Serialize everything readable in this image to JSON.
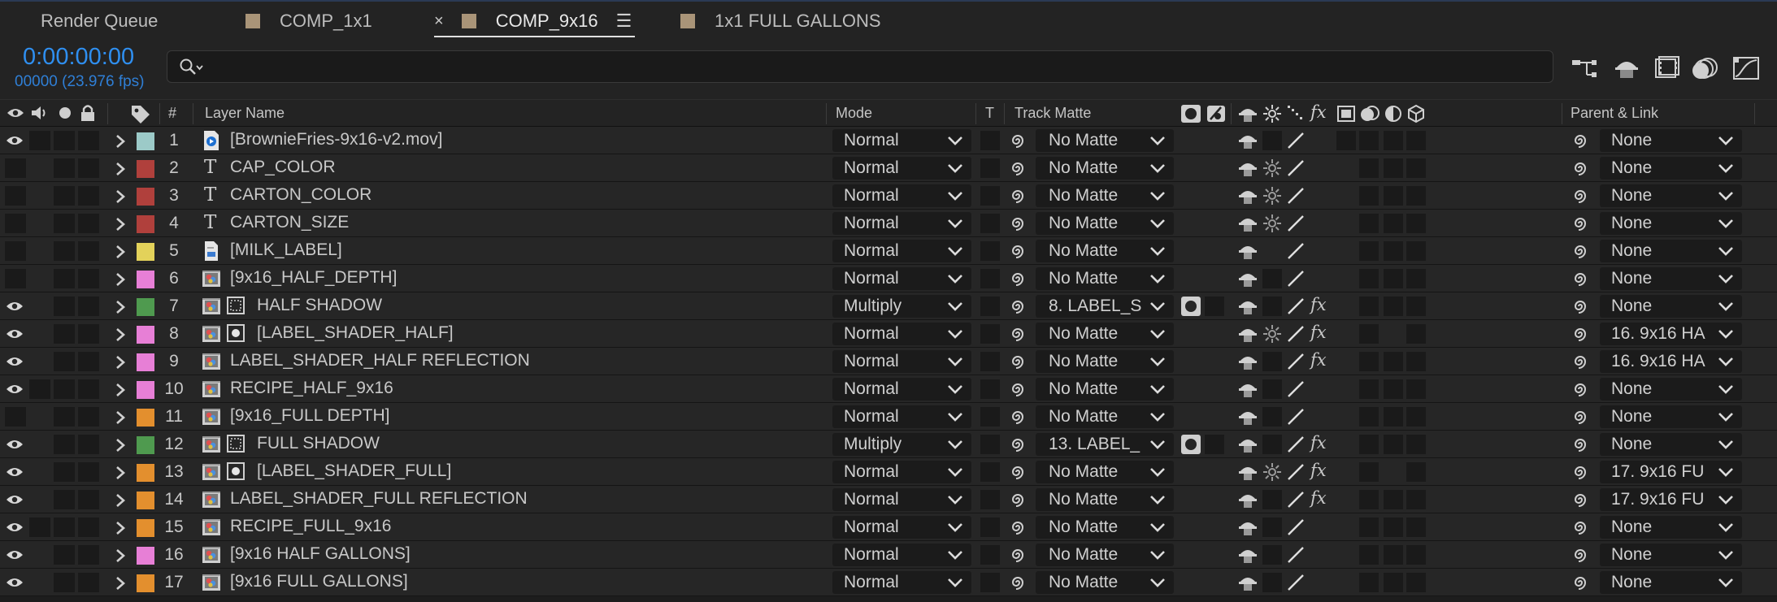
{
  "tabs": [
    {
      "label": "Render Queue",
      "swatch": false,
      "active": false,
      "close": false
    },
    {
      "label": "COMP_1x1",
      "swatch": true,
      "active": false,
      "close": false
    },
    {
      "label": "COMP_9x16",
      "swatch": true,
      "active": true,
      "close": true
    },
    {
      "label": "1x1 FULL GALLONS",
      "swatch": true,
      "active": false,
      "close": false
    }
  ],
  "timeline": {
    "timecode": "0:00:00:00",
    "frames": "00000 (23.976 fps)",
    "search_value": "",
    "search_placeholder": ""
  },
  "toolbar_icons": [
    "draft-3d-icon",
    "shy-layers-icon",
    "frame-blending-icon",
    "motion-blur-icon",
    "graph-editor-icon"
  ],
  "columns": {
    "number": "#",
    "layer_name": "Layer Name",
    "mode": "Mode",
    "t": "T",
    "track_matte": "Track Matte",
    "parent_link": "Parent & Link"
  },
  "colors": {
    "accent_blue": "#2f8ff0",
    "label_cyan": "#9ccac8",
    "label_red": "#b0403c",
    "label_yellow": "#e3d25a",
    "label_pink": "#e77fd6",
    "label_green": "#4f9a4f",
    "label_orange": "#e38f2e"
  },
  "layers": [
    {
      "num": "1",
      "name": "[BrownieFries-9x16-v2.mov]",
      "label": "label_cyan",
      "type": "footage",
      "visible": true,
      "audio": true,
      "mode": "Normal",
      "matte": "No Matte",
      "matte_mode": false,
      "collapse": false,
      "fx": false,
      "parent": "None",
      "switch_boxes": 5
    },
    {
      "num": "2",
      "name": "CAP_COLOR",
      "label": "label_red",
      "type": "text",
      "visible": false,
      "audio": false,
      "mode": "Normal",
      "matte": "No Matte",
      "matte_mode": false,
      "collapse": true,
      "fx": false,
      "parent": "None",
      "switch_boxes": 3
    },
    {
      "num": "3",
      "name": "CARTON_COLOR",
      "label": "label_red",
      "type": "text",
      "visible": false,
      "audio": false,
      "mode": "Normal",
      "matte": "No Matte",
      "matte_mode": false,
      "collapse": true,
      "fx": false,
      "parent": "None",
      "switch_boxes": 3
    },
    {
      "num": "4",
      "name": "CARTON_SIZE",
      "label": "label_red",
      "type": "text",
      "visible": false,
      "audio": false,
      "mode": "Normal",
      "matte": "No Matte",
      "matte_mode": false,
      "collapse": true,
      "fx": false,
      "parent": "None",
      "switch_boxes": 3
    },
    {
      "num": "5",
      "name": "[MILK_LABEL]",
      "label": "label_yellow",
      "type": "file",
      "visible": false,
      "audio": false,
      "mode": "Normal",
      "matte": "No Matte",
      "matte_mode": false,
      "collapse": false,
      "fx": false,
      "parent": "None",
      "switch_boxes": 3
    },
    {
      "num": "6",
      "name": "[9x16_HALF_DEPTH]",
      "label": "label_pink",
      "type": "comp",
      "visible": false,
      "audio": false,
      "mode": "Normal",
      "matte": "No Matte",
      "matte_mode": false,
      "collapse": false,
      "fx": false,
      "parent": "None",
      "switch_boxes": 3
    },
    {
      "num": "7",
      "name": "HALF SHADOW",
      "label": "label_green",
      "type": "comp",
      "sub": "dotted",
      "visible": true,
      "audio": false,
      "mode": "Multiply",
      "matte": "8. LABEL_S",
      "matte_mode": true,
      "collapse": false,
      "fx": true,
      "parent": "None",
      "switch_boxes": 3
    },
    {
      "num": "8",
      "name": "[LABEL_SHADER_HALF]",
      "label": "label_pink",
      "type": "comp",
      "sub": "dot",
      "visible": true,
      "audio": false,
      "mode": "Normal",
      "matte": "No Matte",
      "matte_mode": false,
      "collapse": true,
      "fx": true,
      "parent": "16. 9x16 HA",
      "switch_boxes": 2
    },
    {
      "num": "9",
      "name": "LABEL_SHADER_HALF REFLECTION",
      "label": "label_pink",
      "type": "comp",
      "visible": true,
      "audio": false,
      "mode": "Normal",
      "matte": "No Matte",
      "matte_mode": false,
      "collapse": false,
      "fx": true,
      "parent": "16. 9x16 HA",
      "switch_boxes": 3
    },
    {
      "num": "10",
      "name": "RECIPE_HALF_9x16",
      "label": "label_pink",
      "type": "comp",
      "visible": true,
      "audio": true,
      "mode": "Normal",
      "matte": "No Matte",
      "matte_mode": false,
      "collapse": false,
      "fx": false,
      "parent": "None",
      "switch_boxes": 3
    },
    {
      "num": "11",
      "name": "[9x16_FULL DEPTH]",
      "label": "label_orange",
      "type": "comp",
      "visible": false,
      "audio": false,
      "mode": "Normal",
      "matte": "No Matte",
      "matte_mode": false,
      "collapse": false,
      "fx": false,
      "parent": "None",
      "switch_boxes": 3
    },
    {
      "num": "12",
      "name": "FULL SHADOW",
      "label": "label_green",
      "type": "comp",
      "sub": "dotted",
      "visible": true,
      "audio": false,
      "mode": "Multiply",
      "matte": "13. LABEL_",
      "matte_mode": true,
      "collapse": false,
      "fx": true,
      "parent": "None",
      "switch_boxes": 3
    },
    {
      "num": "13",
      "name": "[LABEL_SHADER_FULL]",
      "label": "label_orange",
      "type": "comp",
      "sub": "dot",
      "visible": true,
      "audio": false,
      "mode": "Normal",
      "matte": "No Matte",
      "matte_mode": false,
      "collapse": true,
      "fx": true,
      "parent": "17. 9x16 FU",
      "switch_boxes": 2
    },
    {
      "num": "14",
      "name": "LABEL_SHADER_FULL REFLECTION",
      "label": "label_orange",
      "type": "comp",
      "visible": true,
      "audio": false,
      "mode": "Normal",
      "matte": "No Matte",
      "matte_mode": false,
      "collapse": false,
      "fx": true,
      "parent": "17. 9x16 FU",
      "switch_boxes": 3
    },
    {
      "num": "15",
      "name": "RECIPE_FULL_9x16",
      "label": "label_orange",
      "type": "comp",
      "visible": true,
      "audio": true,
      "mode": "Normal",
      "matte": "No Matte",
      "matte_mode": false,
      "collapse": false,
      "fx": false,
      "parent": "None",
      "switch_boxes": 3
    },
    {
      "num": "16",
      "name": "[9x16 HALF GALLONS]",
      "label": "label_pink",
      "type": "comp",
      "visible": true,
      "audio": false,
      "mode": "Normal",
      "matte": "No Matte",
      "matte_mode": false,
      "collapse": false,
      "fx": false,
      "parent": "None",
      "switch_boxes": 3
    },
    {
      "num": "17",
      "name": "[9x16 FULL GALLONS]",
      "label": "label_orange",
      "type": "comp",
      "visible": true,
      "audio": false,
      "mode": "Normal",
      "matte": "No Matte",
      "matte_mode": false,
      "collapse": false,
      "fx": false,
      "parent": "None",
      "switch_boxes": 3
    }
  ]
}
